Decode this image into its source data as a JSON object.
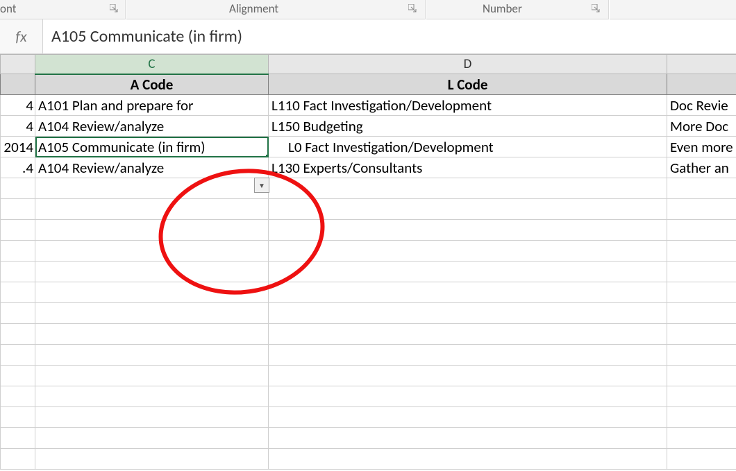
{
  "ribbon": {
    "font_group": "ont",
    "alignment_group": "Alignment",
    "number_group": "Number"
  },
  "formula_bar": {
    "fx_label": "fx",
    "value": "A105 Communicate (in firm)"
  },
  "columns": {
    "colA": "",
    "colC": "C",
    "colD": "D",
    "colE": ""
  },
  "headers": {
    "a_code": "A Code",
    "l_code": "L Code"
  },
  "rows": [
    {
      "date": "4",
      "a": "A101 Plan and prepare for",
      "d": "L110 Fact Investigation/Development",
      "e": "Doc Revie"
    },
    {
      "date": "4",
      "a": "A104 Review/analyze",
      "d": "L150 Budgeting",
      "e": "More Doc"
    },
    {
      "date": "2014",
      "a": "A105 Communicate (in firm)",
      "d": "L0 Fact Investigation/Development",
      "e": "Even more"
    },
    {
      "date": ".4",
      "a": "A104 Review/analyze",
      "d": "L130 Experts/Consultants",
      "e": "Gather an"
    }
  ],
  "dropdown_glyph": "▼"
}
